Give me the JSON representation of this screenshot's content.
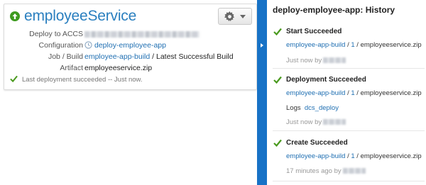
{
  "service": {
    "title": "employeeService",
    "gear_icon": "gear-icon",
    "details": {
      "deploy_label": "Deploy to ACCS",
      "configuration_label": "Configuration",
      "configuration_value": "deploy-employee-app",
      "job_build_label": "Job / Build",
      "job_link": "employee-app-build",
      "build_suffix": " / Latest Successful Build",
      "artifact_label": "Artifact",
      "artifact_value": "employeeservice.zip"
    },
    "status": "Last deployment succeeded -- Just now."
  },
  "history": {
    "title": "deploy-employee-app: History",
    "items": [
      {
        "title": "Start Succeeded",
        "job_link": "employee-app-build",
        "build_link": "1",
        "artifact": " / employeeservice.zip",
        "time": "Just now by"
      },
      {
        "title": "Deployment Succeeded",
        "job_link": "employee-app-build",
        "build_link": "1",
        "artifact": " / employeeservice.zip",
        "logs_label": "Logs",
        "logs_link": "dcs_deploy",
        "time": "Just now by"
      },
      {
        "title": "Create Succeeded",
        "job_link": "employee-app-build",
        "build_link": "1",
        "artifact": " / employeeservice.zip",
        "time": "17 minutes ago by"
      }
    ]
  },
  "colors": {
    "accent": "#1772c6",
    "link": "#1f6fb2",
    "title": "#2a7fbf",
    "success": "#4a9a1e"
  }
}
